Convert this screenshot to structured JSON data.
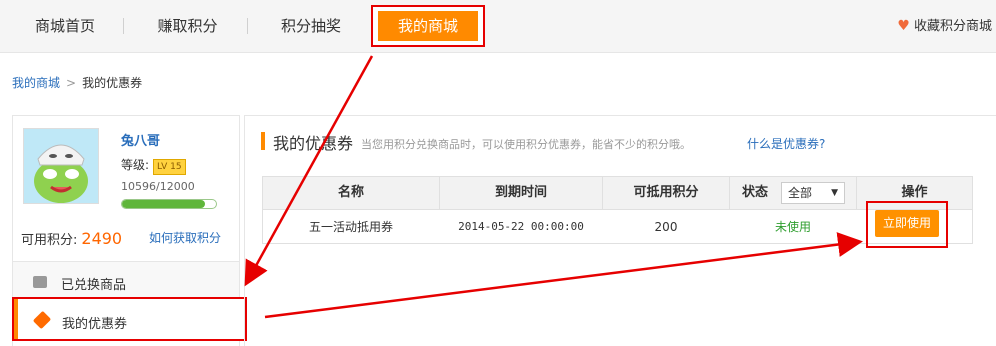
{
  "nav": {
    "items": [
      "商城首页",
      "赚取积分",
      "积分抽奖"
    ],
    "active": "我的商城",
    "favorite": "收藏积分商城"
  },
  "breadcrumb": {
    "root": "我的商城",
    "sep": ">",
    "current": "我的优惠券"
  },
  "profile": {
    "username": "兔八哥",
    "level_label": "等级:",
    "level_badge": "LV 15",
    "exp_text": "10596/12000",
    "exp_progress": 0.883,
    "points_label": "可用积分:",
    "points_value": "2490",
    "how_link": "如何获取积分"
  },
  "sidebar": {
    "items": [
      "已兑换商品",
      "我的优惠券"
    ]
  },
  "main": {
    "title": "我的优惠券",
    "desc": "当您用积分兑换商品时，可以使用积分优惠券，能省不少的积分哦。",
    "what_link": "什么是优惠券?"
  },
  "table": {
    "headers": [
      "名称",
      "到期时间",
      "可抵用积分",
      "状态",
      "操作"
    ],
    "status_select": "全部",
    "rows": [
      {
        "name": "五一活动抵用券",
        "expire": "2014-05-22 00:00:00",
        "points": "200",
        "status": "未使用",
        "action": "立即使用"
      }
    ]
  },
  "colors": {
    "accent": "#ff8a00",
    "highlight": "#e60000",
    "link": "#2a6ebb",
    "unused": "#2e9e2e"
  }
}
